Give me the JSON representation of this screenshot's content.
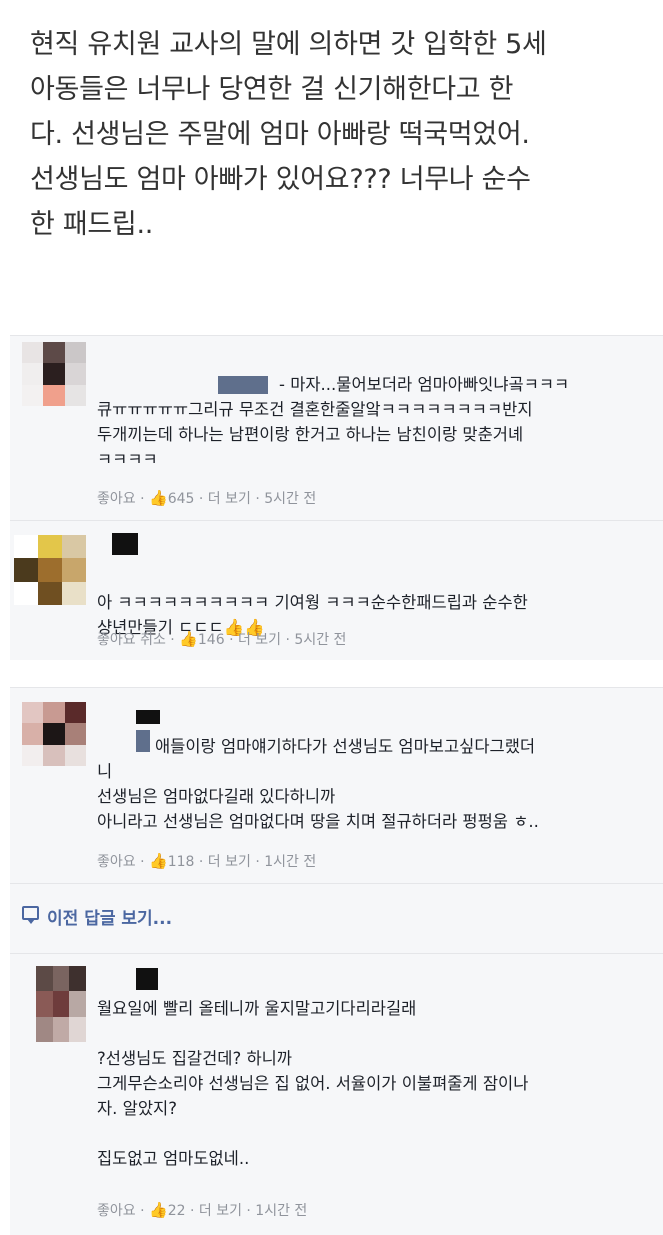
{
  "post": {
    "text": "현직 유치원 교사의 말에 의하면 갓 입학한 5세\n아동들은 너무나 당연한 걸 신기해한다고 한\n다. 선생님은 주말에 엄마 아빠랑 떡국먹었어.\n선생님도 엄마 아빠가 있어요??? 너무나 순수\n한 패드립.."
  },
  "comments": [
    {
      "text": "- 마자...물어보더라 엄마아빠잇냐곸ㅋㅋㅋ\n큐ㅠㅠㅠㅠㅠ그리규 무조건 결혼한줄알앜ㅋㅋㅋㅋㅋㅋㅋㅋ반지\n두개끼는데 하나는 남편이랑 한거고 하나는 남친이랑 맞춘거녜\nㅋㅋㅋㅋ",
      "like": "좋아요 · ",
      "count": "645",
      "rest": " · 더 보기 · 5시간 전"
    },
    {
      "text": "아 ㅋㅋㅋㅋㅋㅋㅋㅋㅋㅋ 기여웡 ㅋㅋㅋ순수한패드립과 순수한\n샹년만들기 ㄷㄷㄷ",
      "thumbs": "👍👍",
      "like": "좋아요 취소 · ",
      "count": "146",
      "rest": " · 더 보기 · 5시간 전"
    },
    {
      "text": "애들이랑 엄마얘기하다가 선생님도 엄마보고싶다그랬더\n니\n선생님은 엄마없다길래 있다하니까\n아니라고 선생님은 엄마없다며 땅을 치며 절규하더라 펑펑움 ㅎ..",
      "like": "좋아요 · ",
      "count": "118",
      "rest": " · 더 보기 · 1시간 전"
    },
    {
      "text": "월요일에 빨리 올테니까 울지말고기다리라길래\n\n?선생님도 집갈건데? 하니까\n그게무슨소리야 선생님은 집 없어. 서율이가 이불펴줄게 잠이나\n자. 알았지?\n\n집도없고 엄마도없네..",
      "like": "좋아요 · ",
      "count": "22",
      "rest": " · 더 보기 · 1시간 전"
    }
  ],
  "previous_replies": "이전 답글 보기...",
  "icons": {
    "like": "thumbs-up-icon",
    "reply": "speech-bubble-icon"
  },
  "colors": {
    "link": "#4b67a1",
    "meta": "#90949c",
    "comment_bg": "#f6f7f9"
  }
}
